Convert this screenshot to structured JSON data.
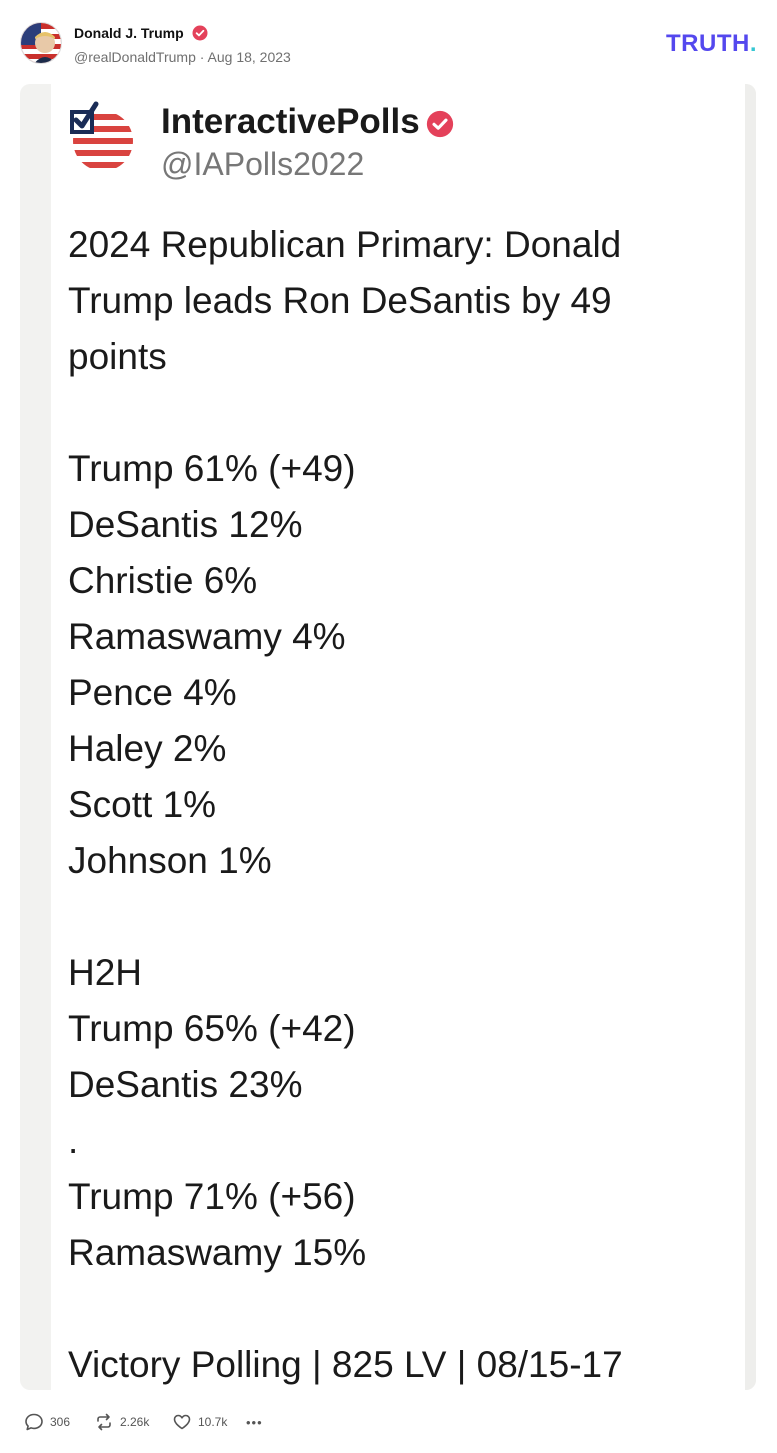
{
  "post": {
    "author_name": "Donald J. Trump",
    "handle_date": "@realDonaldTrump · Aug 18, 2023",
    "platform_logo": "TRUTH",
    "platform_logo_dot": "."
  },
  "embedded": {
    "account_name": "InteractivePolls",
    "account_handle": "@IAPolls2022",
    "lines": [
      "2024 Republican Primary: Donald",
      "Trump leads Ron DeSantis by 49",
      "points",
      "",
      "Trump 61% (+49)",
      "DeSantis 12%",
      "Christie 6%",
      "Ramaswamy 4%",
      "Pence 4%",
      "Haley 2%",
      "Scott 1%",
      "Johnson 1%",
      "",
      "H2H",
      "Trump 65% (+42)",
      "DeSantis 23%",
      ".",
      "Trump 71% (+56)",
      "Ramaswamy 15%",
      "",
      "Victory Polling | 825 LV | 08/15-17"
    ]
  },
  "actions": {
    "replies": "306",
    "retruths": "2.26k",
    "likes": "10.7k",
    "more": "•••"
  },
  "icons": {
    "verified": "verified-badge-icon",
    "reply": "comment-icon",
    "retruth": "repost-icon",
    "like": "heart-icon",
    "more": "more-options-icon"
  },
  "colors": {
    "brand": "#5448ee",
    "brand_dot": "#35c7d3",
    "verified": "#e4415a"
  }
}
